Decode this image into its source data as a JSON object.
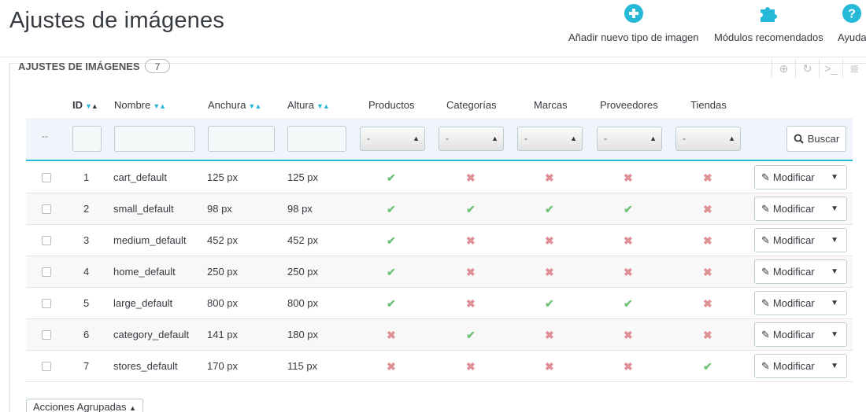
{
  "title": "Ajustes de imágenes",
  "toolbar": [
    {
      "label": "Añadir nuevo tipo de imagen",
      "icon": "add-circle-icon"
    },
    {
      "label": "Módulos recomendados",
      "icon": "puzzle-icon"
    },
    {
      "label": "Ayuda",
      "icon": "help-icon"
    }
  ],
  "panel": {
    "heading": "Ajustes de imágenes",
    "count": "7",
    "icons": [
      "add-icon",
      "refresh-icon",
      "sql-icon",
      "database-icon"
    ]
  },
  "columns": {
    "id": "ID",
    "name": "Nombre",
    "width": "Anchura",
    "height": "Altura",
    "products": "Productos",
    "categories": "Categorías",
    "brands": "Marcas",
    "suppliers": "Proveedores",
    "stores": "Tiendas"
  },
  "filters": {
    "dash": "--",
    "select_value": "-",
    "search_label": "Buscar"
  },
  "rows": [
    {
      "id": "1",
      "name": "cart_default",
      "width": "125 px",
      "height": "125 px",
      "products": true,
      "categories": false,
      "brands": false,
      "suppliers": false,
      "stores": false
    },
    {
      "id": "2",
      "name": "small_default",
      "width": "98 px",
      "height": "98 px",
      "products": true,
      "categories": true,
      "brands": true,
      "suppliers": true,
      "stores": false
    },
    {
      "id": "3",
      "name": "medium_default",
      "width": "452 px",
      "height": "452 px",
      "products": true,
      "categories": false,
      "brands": false,
      "suppliers": false,
      "stores": false
    },
    {
      "id": "4",
      "name": "home_default",
      "width": "250 px",
      "height": "250 px",
      "products": true,
      "categories": false,
      "brands": false,
      "suppliers": false,
      "stores": false
    },
    {
      "id": "5",
      "name": "large_default",
      "width": "800 px",
      "height": "800 px",
      "products": true,
      "categories": false,
      "brands": true,
      "suppliers": true,
      "stores": false
    },
    {
      "id": "6",
      "name": "category_default",
      "width": "141 px",
      "height": "180 px",
      "products": false,
      "categories": true,
      "brands": false,
      "suppliers": false,
      "stores": false
    },
    {
      "id": "7",
      "name": "stores_default",
      "width": "170 px",
      "height": "115 px",
      "products": false,
      "categories": false,
      "brands": false,
      "suppliers": false,
      "stores": true
    }
  ],
  "edit_label": "Modificar",
  "bulk_label": "Acciones Agrupadas",
  "colors": {
    "accent": "#25b9d7",
    "enabled": "#72c279",
    "disabled": "#e08f95"
  }
}
